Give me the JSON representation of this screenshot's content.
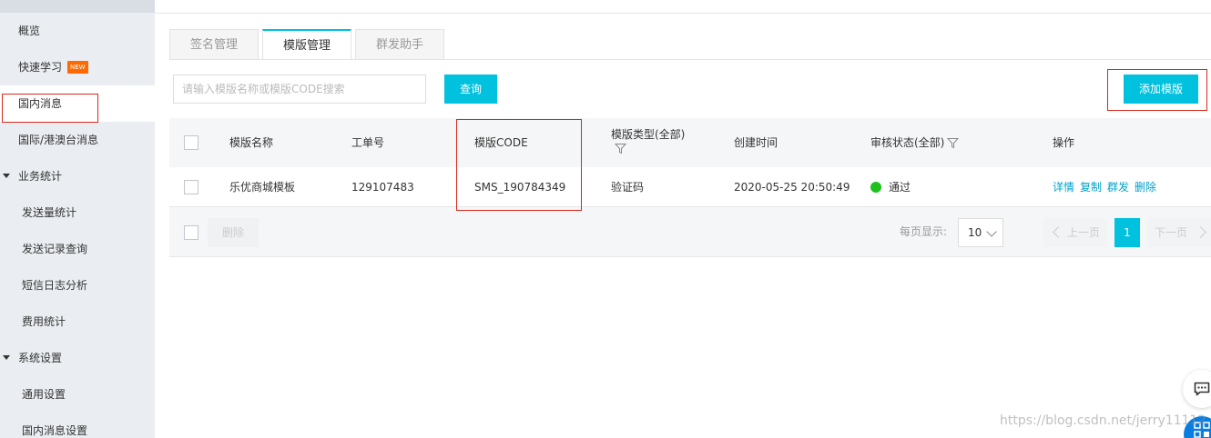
{
  "sidebar": {
    "items": [
      {
        "label": "概览",
        "level": 1
      },
      {
        "label": "快速学习",
        "badge": "NEW",
        "level": 1
      },
      {
        "label": "国内消息",
        "level": 1,
        "active": true
      },
      {
        "label": "国际/港澳台消息",
        "level": 1
      },
      {
        "label": "业务统计",
        "group": true,
        "expanded": true
      },
      {
        "label": "发送量统计",
        "level": 2
      },
      {
        "label": "发送记录查询",
        "level": 2
      },
      {
        "label": "短信日志分析",
        "level": 2
      },
      {
        "label": "费用统计",
        "level": 2
      },
      {
        "label": "系统设置",
        "group": true,
        "expanded": true
      },
      {
        "label": "通用设置",
        "level": 2
      },
      {
        "label": "国内消息设置",
        "level": 2
      }
    ]
  },
  "tabs": [
    {
      "label": "签名管理",
      "active": false
    },
    {
      "label": "模版管理",
      "active": true
    },
    {
      "label": "群发助手",
      "active": false
    }
  ],
  "search": {
    "placeholder": "请输入模版名称或模版CODE搜索",
    "value": ""
  },
  "buttons": {
    "query": "查询",
    "add_template": "添加模版"
  },
  "table": {
    "columns": {
      "name": "模版名称",
      "ticket": "工单号",
      "code": "模版CODE",
      "type": "模版类型(全部)",
      "created": "创建时间",
      "status": "审核状态(全部)",
      "actions": "操作"
    },
    "rows": [
      {
        "name": "乐优商城模板",
        "ticket": "129107483",
        "code": "SMS_190784349",
        "type": "验证码",
        "created": "2020-05-25 20:50:49",
        "status": "通过",
        "status_color": "#1dc11d",
        "actions": [
          "详情",
          "复制",
          "群发",
          "删除"
        ]
      }
    ]
  },
  "footer": {
    "delete": "删除",
    "per_page_label": "每页显示:",
    "per_page": "10",
    "prev": "上一页",
    "current_page": "1",
    "next": "下一页"
  },
  "watermark": "https://blog.csdn.net/jerry11112",
  "colors": {
    "accent": "#00c1de",
    "link": "#00a2ca",
    "annotation": "#d9281b",
    "new_badge": "#ff6a00"
  }
}
